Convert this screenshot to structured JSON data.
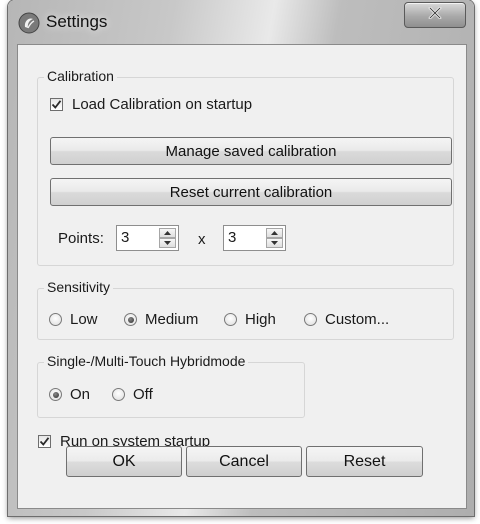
{
  "window": {
    "title": "Settings",
    "icon": "swirl-app-icon",
    "close_icon": "close-icon"
  },
  "calibration": {
    "group_label": "Calibration",
    "load_on_startup_label": "Load Calibration on startup",
    "load_on_startup_checked": true,
    "manage_button": "Manage saved calibration",
    "reset_button": "Reset current calibration",
    "points_label": "Points:",
    "points_x_value": "3",
    "points_separator": "x",
    "points_y_value": "3"
  },
  "sensitivity": {
    "group_label": "Sensitivity",
    "options": [
      "Low",
      "Medium",
      "High",
      "Custom..."
    ],
    "selected": "Medium"
  },
  "touch_mode": {
    "group_label": "Single-/Multi-Touch Hybridmode",
    "options": [
      "On",
      "Off"
    ],
    "selected": "On"
  },
  "run_on_startup": {
    "label": "Run on system startup",
    "checked": true
  },
  "buttons": {
    "ok": "OK",
    "cancel": "Cancel",
    "reset": "Reset"
  }
}
